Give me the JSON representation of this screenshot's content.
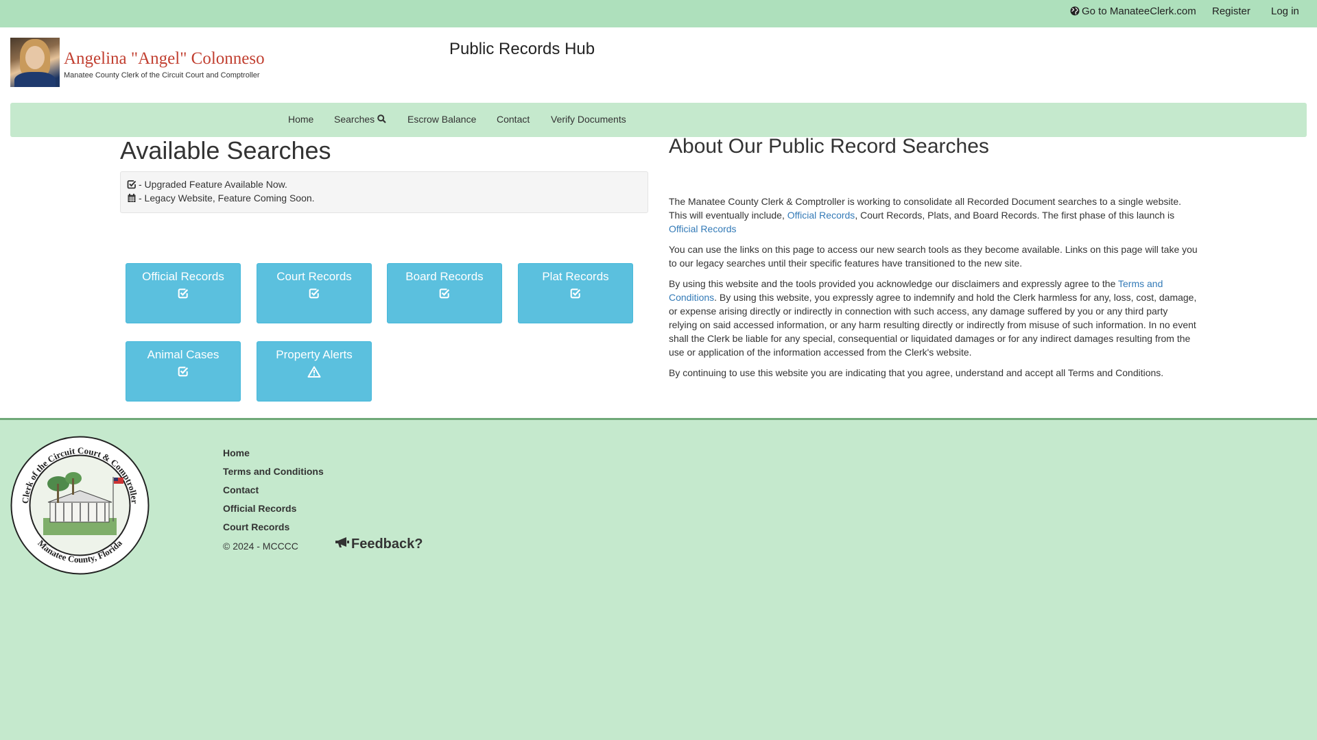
{
  "topbar": {
    "goto_label": "Go to ManateeClerk.com",
    "register_label": "Register",
    "login_label": "Log in"
  },
  "header": {
    "name": "Angelina \"Angel\" Colonneso",
    "subtitle": "Manatee County Clerk of the Circuit Court and Comptroller",
    "hub_title": "Public Records Hub"
  },
  "nav": {
    "items": [
      "Home",
      "Searches",
      "Escrow Balance",
      "Contact",
      "Verify Documents"
    ]
  },
  "searches": {
    "title": "Available Searches",
    "legend": [
      {
        "icon": "check-square-icon",
        "text": "- Upgraded Feature Available Now."
      },
      {
        "icon": "calendar-icon",
        "text": "- Legacy Website, Feature Coming Soon."
      }
    ],
    "tiles": [
      {
        "label": "Official Records",
        "icon": "check-square-icon"
      },
      {
        "label": "Court Records",
        "icon": "check-square-icon"
      },
      {
        "label": "Board Records",
        "icon": "check-square-icon"
      },
      {
        "label": "Plat Records",
        "icon": "check-square-icon"
      },
      {
        "label": "Animal Cases",
        "icon": "check-square-icon"
      },
      {
        "label": "Property Alerts",
        "icon": "warning-icon"
      }
    ]
  },
  "about": {
    "title": "About Our Public Record Searches",
    "p1_a": "The Manatee County Clerk & Comptroller is working to consolidate all Recorded Document searches to a single website. This will eventually include, ",
    "p1_link1": "Official Records",
    "p1_b": ", Court Records, Plats, and Board Records. The first phase of this launch is ",
    "p1_link2": "Official Records",
    "p2": "You can use the links on this page to access our new search tools as they become available. Links on this page will take you to our legacy searches until their specific features have transitioned to the new site.",
    "p3_a": "By using this website and the tools provided you acknowledge our disclaimers and expressly agree to the ",
    "p3_link": "Terms and Conditions",
    "p3_b": ". By using this website, you expressly agree to indemnify and hold the Clerk harmless for any, loss, cost, damage, or expense arising directly or indirectly in connection with such access, any damage suffered by you or any third party relying on said accessed information, or any harm resulting directly or indirectly from misuse of such information. In no event shall the Clerk be liable for any special, consequential or liquidated damages or for any indirect damages resulting from the use or application of the information accessed from the Clerk's website.",
    "p4": "By continuing to use this website you are indicating that you agree, understand and accept all Terms and Conditions."
  },
  "footer": {
    "seal_top_text": "Clerk of the Circuit Court & Comptroller",
    "seal_bottom_text": "Manatee County, Florida",
    "links": [
      "Home",
      "Terms and Conditions",
      "Contact",
      "Official Records",
      "Court Records"
    ],
    "copyright": "© 2024 - MCCCC",
    "feedback_label": "Feedback?"
  },
  "colors": {
    "topbar": "#aee0bc",
    "background": "#c5e9cd",
    "tile": "#5bc0de",
    "link": "#337ab7",
    "name": "#c13f30"
  }
}
